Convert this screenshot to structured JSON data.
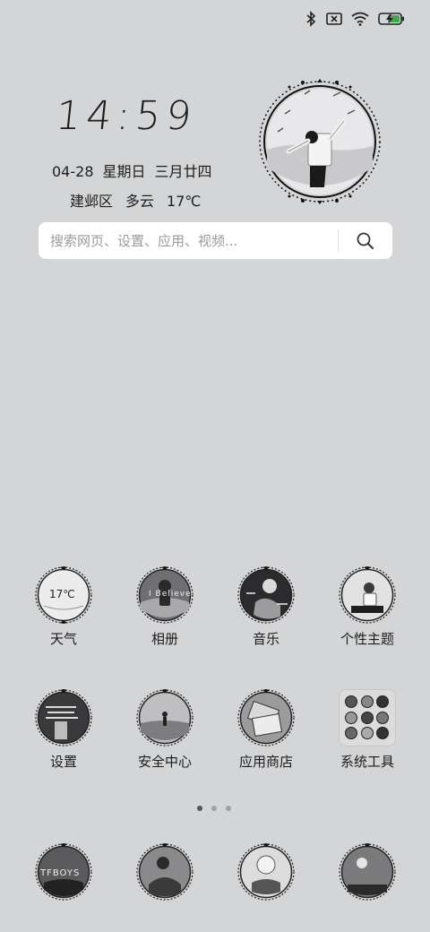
{
  "status_bar": {
    "icons": [
      "bluetooth-icon",
      "no-sim-icon",
      "wifi-icon",
      "battery-charging-icon"
    ]
  },
  "clock_widget": {
    "time": "14:59",
    "date": "04-28",
    "weekday": "星期日",
    "lunar": "三月廿四",
    "district": "建邺区",
    "condition": "多云",
    "temperature": "17℃"
  },
  "search": {
    "placeholder": "搜索网页、设置、应用、视频..."
  },
  "apps": [
    {
      "label": "天气",
      "badge": "17℃"
    },
    {
      "label": "相册",
      "badge": "I Believe"
    },
    {
      "label": "音乐"
    },
    {
      "label": "个性主题"
    },
    {
      "label": "设置"
    },
    {
      "label": "安全中心"
    },
    {
      "label": "应用商店"
    },
    {
      "label": "系统工具"
    }
  ],
  "pager": {
    "pages": 3,
    "current": 1
  },
  "dock": {
    "apps": [
      {
        "badge": "TFBOYS"
      },
      {
        "badge": ""
      },
      {
        "badge": ""
      },
      {
        "badge": ""
      }
    ]
  },
  "colors": {
    "background": "#d4d5d7",
    "accent_battery": "#3ea94a"
  }
}
